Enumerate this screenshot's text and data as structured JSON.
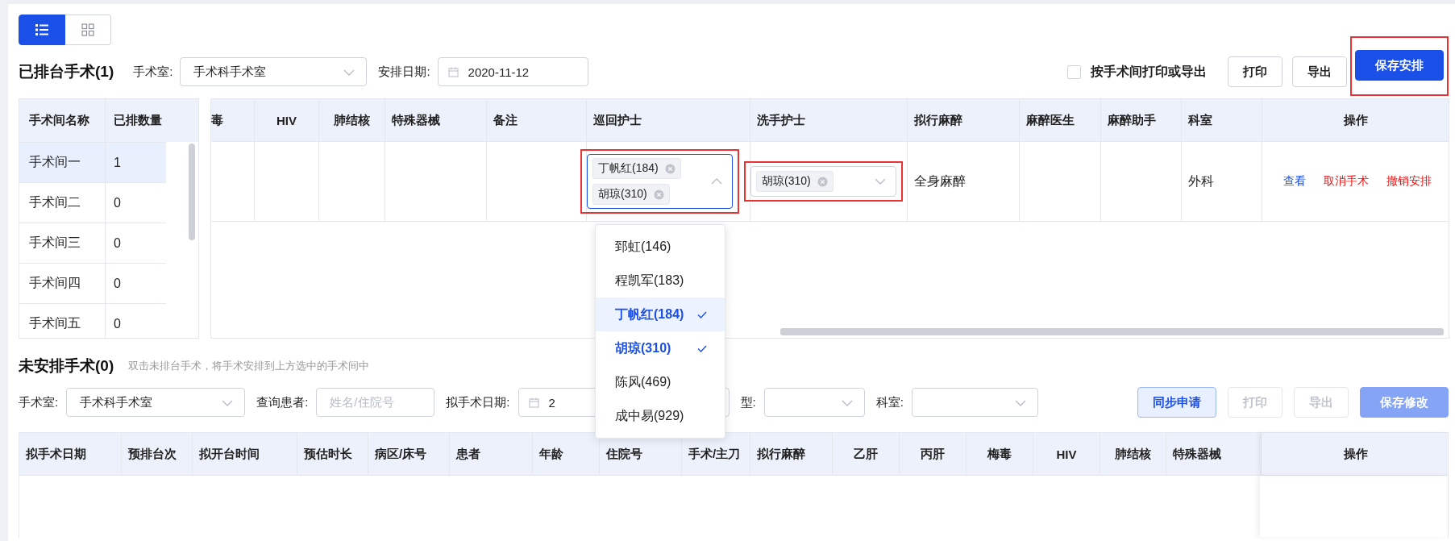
{
  "view_toggle": [
    {
      "kind": "list",
      "selected": true
    },
    {
      "kind": "grid",
      "selected": false
    }
  ],
  "scheduled": {
    "title": "已排台手术(1)",
    "filters": [
      {
        "label": "手术室:",
        "kind": "select",
        "value": "手术科手术室"
      },
      {
        "label": "安排日期:",
        "kind": "date",
        "value": "2020-11-12"
      }
    ],
    "print_by_room": {
      "label": "按手术间打印或导出",
      "checked": false
    },
    "buttons": [
      {
        "label": "打印",
        "kind": "default",
        "highlighted": false
      },
      {
        "label": "导出",
        "kind": "default",
        "highlighted": false
      },
      {
        "label": "保存安排",
        "kind": "primary",
        "highlighted": true
      }
    ],
    "rooms": {
      "columns": [
        "手术间名称",
        "已排数量"
      ],
      "rows": [
        {
          "name": "手术间一",
          "count": "1",
          "selected": true
        },
        {
          "name": "手术间二",
          "count": "0",
          "selected": false
        },
        {
          "name": "手术间三",
          "count": "0",
          "selected": false
        },
        {
          "name": "手术间四",
          "count": "0",
          "selected": false
        },
        {
          "name": "手术间五",
          "count": "0",
          "selected": false
        }
      ]
    },
    "table": {
      "columns": [
        "毒",
        "HIV",
        "肺结核",
        "特殊器械",
        "备注",
        "巡回护士",
        "洗手护士",
        "拟行麻醉",
        "麻醉医生",
        "麻醉助手",
        "科室",
        "操作"
      ],
      "rows": [
        {
          "cells": [
            {
              "kind": "empty"
            },
            {
              "kind": "empty"
            },
            {
              "kind": "empty"
            },
            {
              "kind": "empty"
            },
            {
              "kind": "empty"
            },
            {
              "kind": "multi_select",
              "highlighted": true,
              "open": true,
              "tags": [
                "丁帆红(184)",
                "胡琼(310)"
              ],
              "options": [
                {
                  "label": "郅虹(146)",
                  "selected": false
                },
                {
                  "label": "程凯军(183)",
                  "selected": false
                },
                {
                  "label": "丁帆红(184)",
                  "selected": true
                },
                {
                  "label": "胡琼(310)",
                  "selected": true
                },
                {
                  "label": "陈风(469)",
                  "selected": false
                },
                {
                  "label": "成中易(929)",
                  "selected": false
                }
              ]
            },
            {
              "kind": "select",
              "highlighted": true,
              "open": false,
              "tags": [
                "胡琼(310)"
              ]
            },
            {
              "kind": "text",
              "value": "全身麻醉"
            },
            {
              "kind": "empty"
            },
            {
              "kind": "empty"
            },
            {
              "kind": "text",
              "value": "外科"
            },
            {
              "kind": "actions",
              "actions": [
                {
                  "label": "查看",
                  "kind": "link"
                },
                {
                  "label": "取消手术",
                  "kind": "danger"
                },
                {
                  "label": "撤销安排",
                  "kind": "danger"
                }
              ]
            }
          ]
        }
      ]
    }
  },
  "unscheduled": {
    "title": "未安排手术(0)",
    "hint": "双击未排台手术，将手术安排到上方选中的手术间中",
    "filters": [
      {
        "label": "手术室:",
        "kind": "select",
        "value": "手术科手术室"
      },
      {
        "label": "查询患者:",
        "kind": "input",
        "placeholder": "姓名/住院号"
      },
      {
        "label": "拟手术日期:",
        "kind": "date",
        "value": "2"
      },
      {
        "label": "型:",
        "kind": "select"
      },
      {
        "label": "科室:",
        "kind": "select"
      }
    ],
    "buttons": [
      {
        "label": "同步申请",
        "kind": "secondary",
        "disabled": false
      },
      {
        "label": "打印",
        "kind": "default",
        "disabled": true
      },
      {
        "label": "导出",
        "kind": "default",
        "disabled": true
      },
      {
        "label": "保存修改",
        "kind": "primary",
        "disabled": true
      }
    ],
    "table": {
      "columns": [
        "拟手术日期",
        "预排台次",
        "拟开台时间",
        "预估时长",
        "病区/床号",
        "患者",
        "年龄",
        "住院号",
        "手术/主刀",
        "拟行麻醉",
        "乙肝",
        "丙肝",
        "梅毒",
        "HIV",
        "肺结核",
        "特殊器械",
        "操作"
      ]
    }
  }
}
